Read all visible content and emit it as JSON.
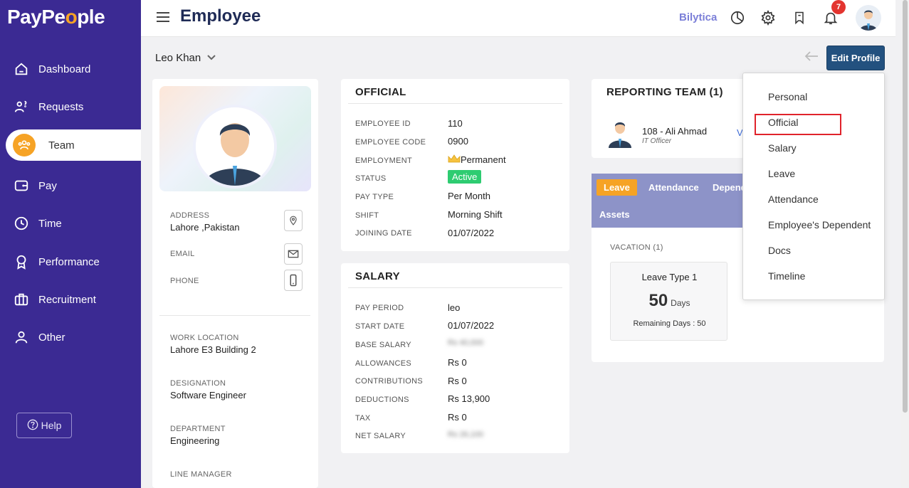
{
  "app": {
    "logo_pre": "PayPe",
    "logo_o": "o",
    "logo_post": "ple"
  },
  "sidebar": {
    "items": [
      {
        "label": "Dashboard",
        "icon": "home-icon"
      },
      {
        "label": "Requests",
        "icon": "requests-icon"
      },
      {
        "label": "Team",
        "icon": "team-icon"
      },
      {
        "label": "Pay",
        "icon": "wallet-icon"
      },
      {
        "label": "Time",
        "icon": "clock-icon"
      },
      {
        "label": "Performance",
        "icon": "award-icon"
      },
      {
        "label": "Recruitment",
        "icon": "briefcase-icon"
      },
      {
        "label": "Other",
        "icon": "user-icon"
      }
    ],
    "help_label": "Help"
  },
  "header": {
    "title": "Employee",
    "brand": "Bilytica",
    "notifications": "7"
  },
  "subheader": {
    "employee": "Leo Khan",
    "edit_label": "Edit Profile"
  },
  "profile": {
    "address_label": "ADDRESS",
    "address": "Lahore ,Pakistan",
    "email_label": "EMAIL",
    "phone_label": "PHONE",
    "work_location_label": "WORK LOCATION",
    "work_location": "Lahore E3 Building 2",
    "designation_label": "DESIGNATION",
    "designation": "Software Engineer",
    "department_label": "DEPARTMENT",
    "department": "Engineering",
    "line_manager_label": "LINE MANAGER"
  },
  "official": {
    "title": "OFFICIAL",
    "rows": [
      {
        "label": "EMPLOYEE ID",
        "value": "110"
      },
      {
        "label": "EMPLOYEE CODE",
        "value": "0900"
      },
      {
        "label": "EMPLOYMENT",
        "value": "Permanent"
      },
      {
        "label": "STATUS",
        "value": "Active"
      },
      {
        "label": "PAY TYPE",
        "value": "Per Month"
      },
      {
        "label": "SHIFT",
        "value": "Morning Shift"
      },
      {
        "label": "JOINING DATE",
        "value": "01/07/2022"
      }
    ]
  },
  "salary": {
    "title": "SALARY",
    "rows": [
      {
        "label": "PAY PERIOD",
        "value": "leo"
      },
      {
        "label": "START DATE",
        "value": "01/07/2022"
      },
      {
        "label": "BASE SALARY",
        "value": "Rs 40,000"
      },
      {
        "label": "ALLOWANCES",
        "value": "Rs 0"
      },
      {
        "label": "CONTRIBUTIONS",
        "value": "Rs 0"
      },
      {
        "label": "DEDUCTIONS",
        "value": "Rs 13,900"
      },
      {
        "label": "TAX",
        "value": "Rs 0"
      },
      {
        "label": "NET SALARY",
        "value": "Rs 26,100"
      }
    ]
  },
  "team": {
    "title": "REPORTING TEAM (1)",
    "member_name": "108 - Ali Ahmad",
    "member_role": "IT Officer",
    "view_label": "V"
  },
  "leave": {
    "tabs": [
      "Leave",
      "Attendance",
      "Depend",
      "Assets"
    ],
    "section": "VACATION (1)",
    "type": "Leave Type 1",
    "days": "50",
    "days_unit": "Days",
    "remaining": "Remaining Days : 50"
  },
  "menu": {
    "items": [
      "Personal",
      "Official",
      "Salary",
      "Leave",
      "Attendance",
      "Employee's Dependent",
      "Docs",
      "Timeline"
    ]
  },
  "colors": {
    "sidebar": "#3b2a93",
    "accent": "#f6a325",
    "primary_btn": "#23517f",
    "status_active": "#2ecc71",
    "highlight": "#e0232b"
  }
}
